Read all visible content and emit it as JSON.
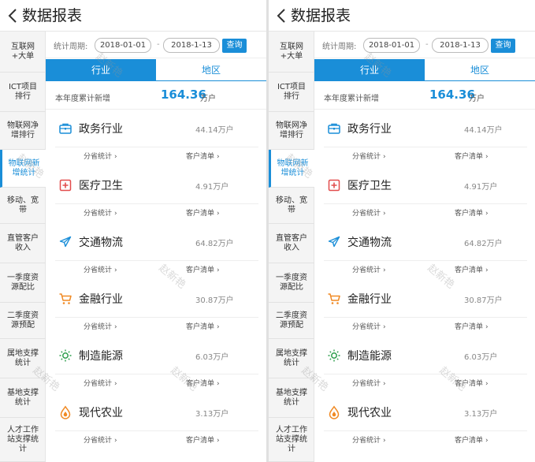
{
  "header": {
    "title": "数据报表"
  },
  "sidebar": {
    "items": [
      {
        "label": "互联网+大单"
      },
      {
        "label": "ICT项目排行"
      },
      {
        "label": "物联网净增排行"
      },
      {
        "label": "物联网新增统计"
      },
      {
        "label": "移动、宽带"
      },
      {
        "label": "直管客户收入"
      },
      {
        "label": "一季度资源配比"
      },
      {
        "label": "二季度资源预配"
      },
      {
        "label": "属地支撑统计"
      },
      {
        "label": "基地支撑统计"
      },
      {
        "label": "人才工作站支撑统计"
      }
    ]
  },
  "filter": {
    "label": "统计周期:",
    "start_date": "2018-01-01",
    "dash": "-",
    "end_date": "2018-1-13",
    "query_label": "查询"
  },
  "tabs": [
    {
      "label": "行业"
    },
    {
      "label": "地区"
    }
  ],
  "summary": {
    "label": "本年度累计新增",
    "value": "164.36",
    "unit": "万户"
  },
  "industries": [
    {
      "name": "政务行业",
      "value": "44.14万户",
      "icon": "briefcase-icon",
      "color": "#1a8ed8"
    },
    {
      "name": "医疗卫生",
      "value": "4.91万户",
      "icon": "medical-cross-icon",
      "color": "#e24c4c"
    },
    {
      "name": "交通物流",
      "value": "64.82万户",
      "icon": "airplane-icon",
      "color": "#1a8ed8"
    },
    {
      "name": "金融行业",
      "value": "30.87万户",
      "icon": "shopping-cart-icon",
      "color": "#f08a24"
    },
    {
      "name": "制造能源",
      "value": "6.03万户",
      "icon": "sun-icon",
      "color": "#2a9d4a"
    },
    {
      "name": "现代农业",
      "value": "3.13万户",
      "icon": "water-drop-icon",
      "color": "#f08a24"
    }
  ],
  "links": {
    "province": "分省统计",
    "customer": "客户清单"
  },
  "watermark": "赵新艳"
}
